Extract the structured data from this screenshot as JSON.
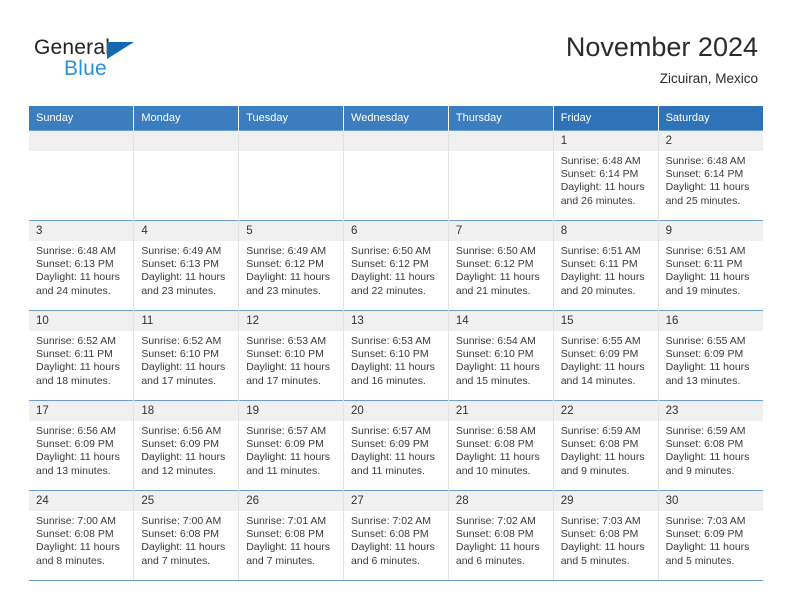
{
  "brand": {
    "name_part1": "General",
    "name_part2": "Blue",
    "triangle_icon": "triangle-icon",
    "accent_color": "#1268b3",
    "secondary_color": "#2a91d8"
  },
  "header": {
    "title": "November 2024",
    "subtitle": "Zicuiran, Mexico"
  },
  "theme": {
    "header_blue": "#3b7dbf",
    "header_blue_weekend": "#2f72b8",
    "row_divider_blue": "#6b9fd2",
    "daynum_band": "#f0f0f0"
  },
  "weekdays": [
    {
      "label": "Sunday",
      "weekend": false
    },
    {
      "label": "Monday",
      "weekend": false
    },
    {
      "label": "Tuesday",
      "weekend": false
    },
    {
      "label": "Wednesday",
      "weekend": false
    },
    {
      "label": "Thursday",
      "weekend": false
    },
    {
      "label": "Friday",
      "weekend": true
    },
    {
      "label": "Saturday",
      "weekend": true
    }
  ],
  "weeks": [
    [
      {
        "day": "",
        "sunrise": "",
        "sunset": "",
        "daylight_line1": "",
        "daylight_line2": ""
      },
      {
        "day": "",
        "sunrise": "",
        "sunset": "",
        "daylight_line1": "",
        "daylight_line2": ""
      },
      {
        "day": "",
        "sunrise": "",
        "sunset": "",
        "daylight_line1": "",
        "daylight_line2": ""
      },
      {
        "day": "",
        "sunrise": "",
        "sunset": "",
        "daylight_line1": "",
        "daylight_line2": ""
      },
      {
        "day": "",
        "sunrise": "",
        "sunset": "",
        "daylight_line1": "",
        "daylight_line2": ""
      },
      {
        "day": "1",
        "sunrise": "Sunrise: 6:48 AM",
        "sunset": "Sunset: 6:14 PM",
        "daylight_line1": "Daylight: 11 hours",
        "daylight_line2": "and 26 minutes."
      },
      {
        "day": "2",
        "sunrise": "Sunrise: 6:48 AM",
        "sunset": "Sunset: 6:14 PM",
        "daylight_line1": "Daylight: 11 hours",
        "daylight_line2": "and 25 minutes."
      }
    ],
    [
      {
        "day": "3",
        "sunrise": "Sunrise: 6:48 AM",
        "sunset": "Sunset: 6:13 PM",
        "daylight_line1": "Daylight: 11 hours",
        "daylight_line2": "and 24 minutes."
      },
      {
        "day": "4",
        "sunrise": "Sunrise: 6:49 AM",
        "sunset": "Sunset: 6:13 PM",
        "daylight_line1": "Daylight: 11 hours",
        "daylight_line2": "and 23 minutes."
      },
      {
        "day": "5",
        "sunrise": "Sunrise: 6:49 AM",
        "sunset": "Sunset: 6:12 PM",
        "daylight_line1": "Daylight: 11 hours",
        "daylight_line2": "and 23 minutes."
      },
      {
        "day": "6",
        "sunrise": "Sunrise: 6:50 AM",
        "sunset": "Sunset: 6:12 PM",
        "daylight_line1": "Daylight: 11 hours",
        "daylight_line2": "and 22 minutes."
      },
      {
        "day": "7",
        "sunrise": "Sunrise: 6:50 AM",
        "sunset": "Sunset: 6:12 PM",
        "daylight_line1": "Daylight: 11 hours",
        "daylight_line2": "and 21 minutes."
      },
      {
        "day": "8",
        "sunrise": "Sunrise: 6:51 AM",
        "sunset": "Sunset: 6:11 PM",
        "daylight_line1": "Daylight: 11 hours",
        "daylight_line2": "and 20 minutes."
      },
      {
        "day": "9",
        "sunrise": "Sunrise: 6:51 AM",
        "sunset": "Sunset: 6:11 PM",
        "daylight_line1": "Daylight: 11 hours",
        "daylight_line2": "and 19 minutes."
      }
    ],
    [
      {
        "day": "10",
        "sunrise": "Sunrise: 6:52 AM",
        "sunset": "Sunset: 6:11 PM",
        "daylight_line1": "Daylight: 11 hours",
        "daylight_line2": "and 18 minutes."
      },
      {
        "day": "11",
        "sunrise": "Sunrise: 6:52 AM",
        "sunset": "Sunset: 6:10 PM",
        "daylight_line1": "Daylight: 11 hours",
        "daylight_line2": "and 17 minutes."
      },
      {
        "day": "12",
        "sunrise": "Sunrise: 6:53 AM",
        "sunset": "Sunset: 6:10 PM",
        "daylight_line1": "Daylight: 11 hours",
        "daylight_line2": "and 17 minutes."
      },
      {
        "day": "13",
        "sunrise": "Sunrise: 6:53 AM",
        "sunset": "Sunset: 6:10 PM",
        "daylight_line1": "Daylight: 11 hours",
        "daylight_line2": "and 16 minutes."
      },
      {
        "day": "14",
        "sunrise": "Sunrise: 6:54 AM",
        "sunset": "Sunset: 6:10 PM",
        "daylight_line1": "Daylight: 11 hours",
        "daylight_line2": "and 15 minutes."
      },
      {
        "day": "15",
        "sunrise": "Sunrise: 6:55 AM",
        "sunset": "Sunset: 6:09 PM",
        "daylight_line1": "Daylight: 11 hours",
        "daylight_line2": "and 14 minutes."
      },
      {
        "day": "16",
        "sunrise": "Sunrise: 6:55 AM",
        "sunset": "Sunset: 6:09 PM",
        "daylight_line1": "Daylight: 11 hours",
        "daylight_line2": "and 13 minutes."
      }
    ],
    [
      {
        "day": "17",
        "sunrise": "Sunrise: 6:56 AM",
        "sunset": "Sunset: 6:09 PM",
        "daylight_line1": "Daylight: 11 hours",
        "daylight_line2": "and 13 minutes."
      },
      {
        "day": "18",
        "sunrise": "Sunrise: 6:56 AM",
        "sunset": "Sunset: 6:09 PM",
        "daylight_line1": "Daylight: 11 hours",
        "daylight_line2": "and 12 minutes."
      },
      {
        "day": "19",
        "sunrise": "Sunrise: 6:57 AM",
        "sunset": "Sunset: 6:09 PM",
        "daylight_line1": "Daylight: 11 hours",
        "daylight_line2": "and 11 minutes."
      },
      {
        "day": "20",
        "sunrise": "Sunrise: 6:57 AM",
        "sunset": "Sunset: 6:09 PM",
        "daylight_line1": "Daylight: 11 hours",
        "daylight_line2": "and 11 minutes."
      },
      {
        "day": "21",
        "sunrise": "Sunrise: 6:58 AM",
        "sunset": "Sunset: 6:08 PM",
        "daylight_line1": "Daylight: 11 hours",
        "daylight_line2": "and 10 minutes."
      },
      {
        "day": "22",
        "sunrise": "Sunrise: 6:59 AM",
        "sunset": "Sunset: 6:08 PM",
        "daylight_line1": "Daylight: 11 hours",
        "daylight_line2": "and 9 minutes."
      },
      {
        "day": "23",
        "sunrise": "Sunrise: 6:59 AM",
        "sunset": "Sunset: 6:08 PM",
        "daylight_line1": "Daylight: 11 hours",
        "daylight_line2": "and 9 minutes."
      }
    ],
    [
      {
        "day": "24",
        "sunrise": "Sunrise: 7:00 AM",
        "sunset": "Sunset: 6:08 PM",
        "daylight_line1": "Daylight: 11 hours",
        "daylight_line2": "and 8 minutes."
      },
      {
        "day": "25",
        "sunrise": "Sunrise: 7:00 AM",
        "sunset": "Sunset: 6:08 PM",
        "daylight_line1": "Daylight: 11 hours",
        "daylight_line2": "and 7 minutes."
      },
      {
        "day": "26",
        "sunrise": "Sunrise: 7:01 AM",
        "sunset": "Sunset: 6:08 PM",
        "daylight_line1": "Daylight: 11 hours",
        "daylight_line2": "and 7 minutes."
      },
      {
        "day": "27",
        "sunrise": "Sunrise: 7:02 AM",
        "sunset": "Sunset: 6:08 PM",
        "daylight_line1": "Daylight: 11 hours",
        "daylight_line2": "and 6 minutes."
      },
      {
        "day": "28",
        "sunrise": "Sunrise: 7:02 AM",
        "sunset": "Sunset: 6:08 PM",
        "daylight_line1": "Daylight: 11 hours",
        "daylight_line2": "and 6 minutes."
      },
      {
        "day": "29",
        "sunrise": "Sunrise: 7:03 AM",
        "sunset": "Sunset: 6:08 PM",
        "daylight_line1": "Daylight: 11 hours",
        "daylight_line2": "and 5 minutes."
      },
      {
        "day": "30",
        "sunrise": "Sunrise: 7:03 AM",
        "sunset": "Sunset: 6:09 PM",
        "daylight_line1": "Daylight: 11 hours",
        "daylight_line2": "and 5 minutes."
      }
    ]
  ]
}
